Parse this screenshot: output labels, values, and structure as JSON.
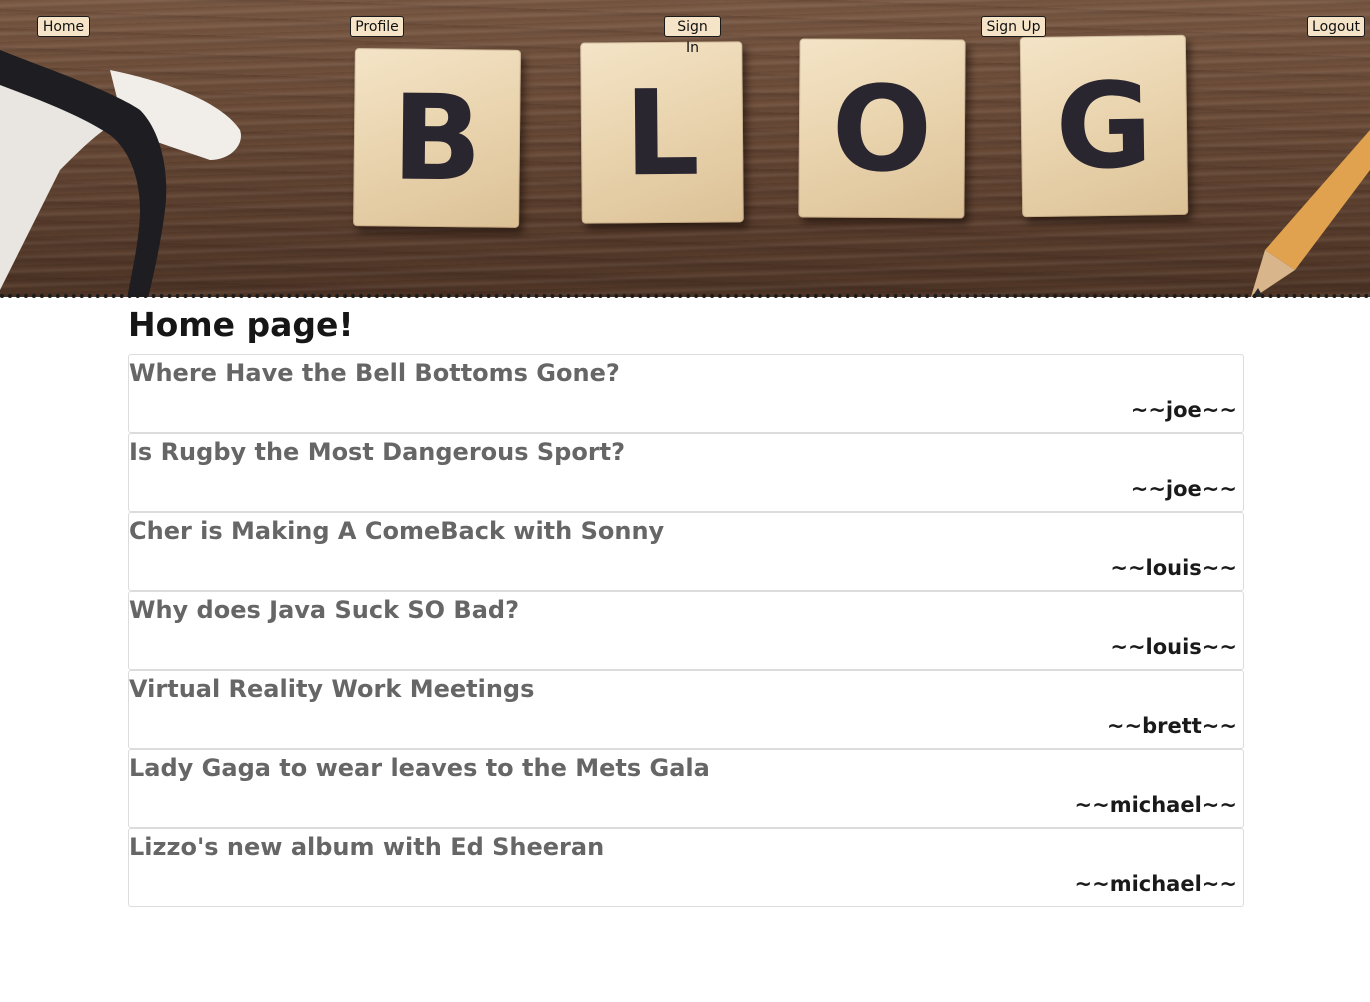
{
  "nav": {
    "home": "Home",
    "profile": "Profile",
    "sign_in": "Sign In",
    "sign_up": "Sign Up",
    "logout": "Logout"
  },
  "banner": {
    "tiles": [
      "B",
      "L",
      "O",
      "G"
    ]
  },
  "main": {
    "title": "Home page!",
    "posts": [
      {
        "title": "Where Have the Bell Bottoms Gone?",
        "author": "~~joe~~"
      },
      {
        "title": "Is Rugby the Most Dangerous Sport?",
        "author": "~~joe~~"
      },
      {
        "title": "Cher is Making A ComeBack with Sonny",
        "author": "~~louis~~"
      },
      {
        "title": "Why does Java Suck SO Bad?",
        "author": "~~louis~~"
      },
      {
        "title": "Virtual Reality Work Meetings",
        "author": "~~brett~~"
      },
      {
        "title": "Lady Gaga to wear leaves to the Mets Gala",
        "author": "~~michael~~"
      },
      {
        "title": "Lizzo's new album with Ed Sheeran",
        "author": "~~michael~~"
      }
    ]
  },
  "colors": {
    "nav_button_bg": "#f5e4c8",
    "post_title": "#666666",
    "post_author": "#1a1a1a",
    "post_border": "#dcdcdc"
  }
}
